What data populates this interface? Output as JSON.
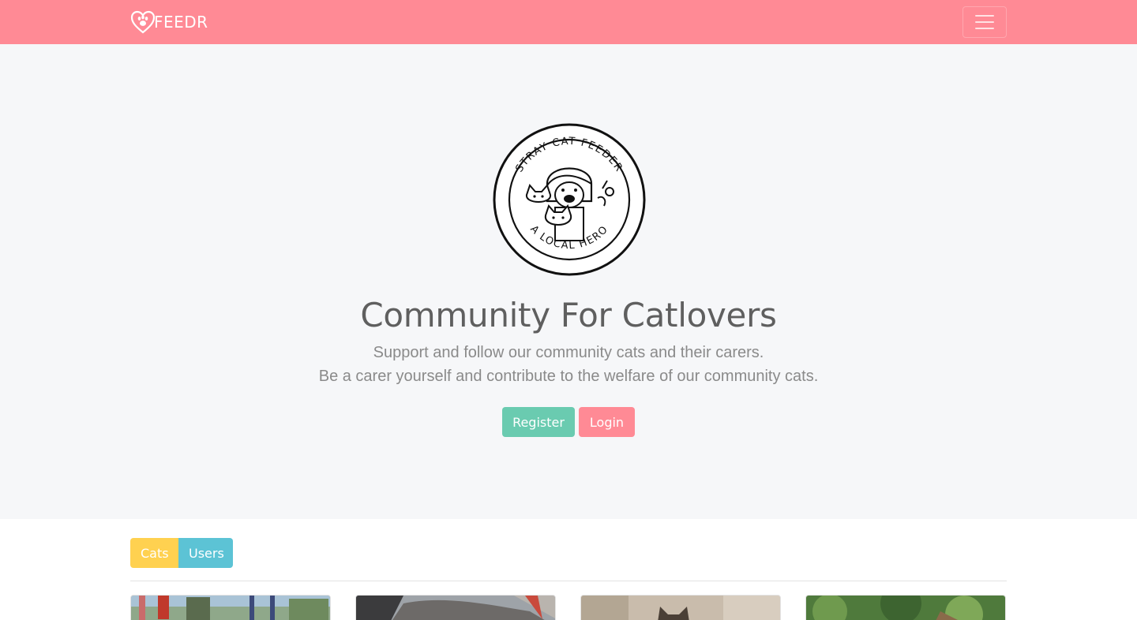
{
  "navbar": {
    "brand": "FEEDR",
    "brand_icon": "paw-heart-icon",
    "menu_icon": "hamburger-menu-icon",
    "color": "#ff8a95"
  },
  "hero": {
    "emblem_text_top": "STRAY CAT FEEDER",
    "emblem_text_bottom": "A LOCAL HERO",
    "title": "Community For Catlovers",
    "line1": "Support and follow our community cats and their carers.",
    "line2": "Be a carer yourself and contribute to the welfare of our community cats.",
    "register_label": "Register",
    "login_label": "Login",
    "register_color": "#6acbb0",
    "login_color": "#ff8a95"
  },
  "tabs": [
    {
      "label": "Cats",
      "color": "#ffd150"
    },
    {
      "label": "Users",
      "color": "#5cc3d5"
    }
  ],
  "cards_visible": 4
}
